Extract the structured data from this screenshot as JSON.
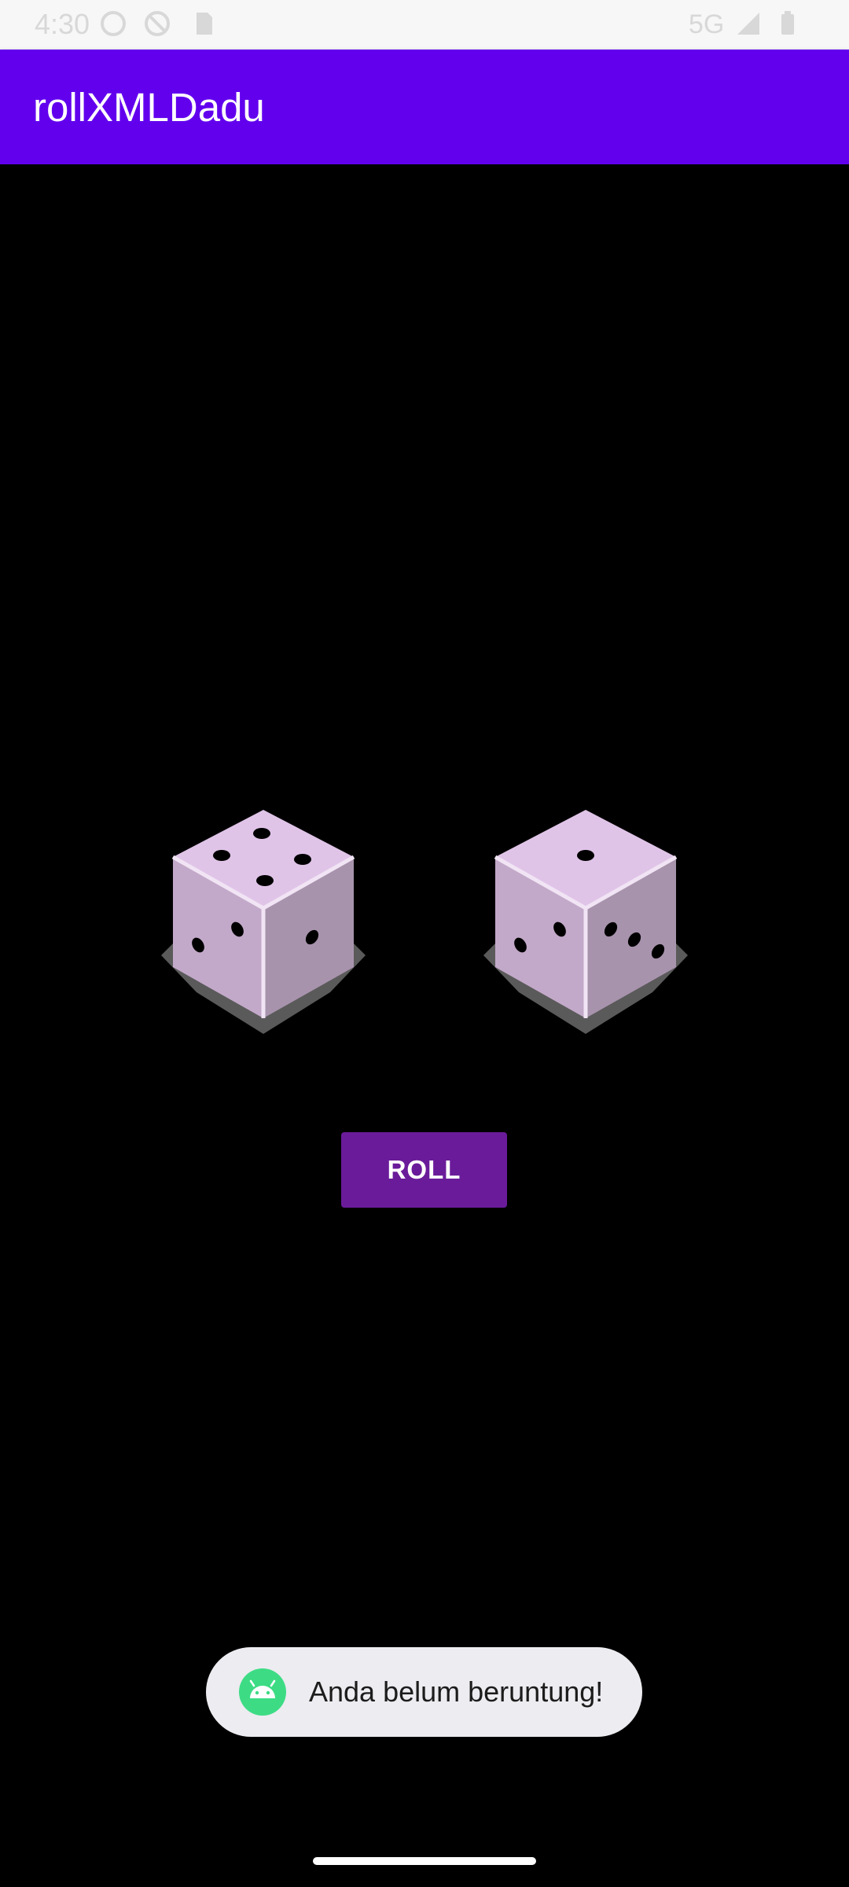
{
  "status_bar": {
    "time": "4:30",
    "network": "5G"
  },
  "app_bar": {
    "title": "rollXMLDadu"
  },
  "dice": {
    "left_value": 4,
    "right_value": 1,
    "face_color": "#dcc6e6",
    "pip_color": "#000000"
  },
  "roll_button": {
    "label": "ROLL"
  },
  "toast": {
    "message": "Anda belum beruntung!"
  },
  "colors": {
    "app_bar": "#6200ee",
    "button": "#6a1b9a",
    "background": "#000000"
  }
}
